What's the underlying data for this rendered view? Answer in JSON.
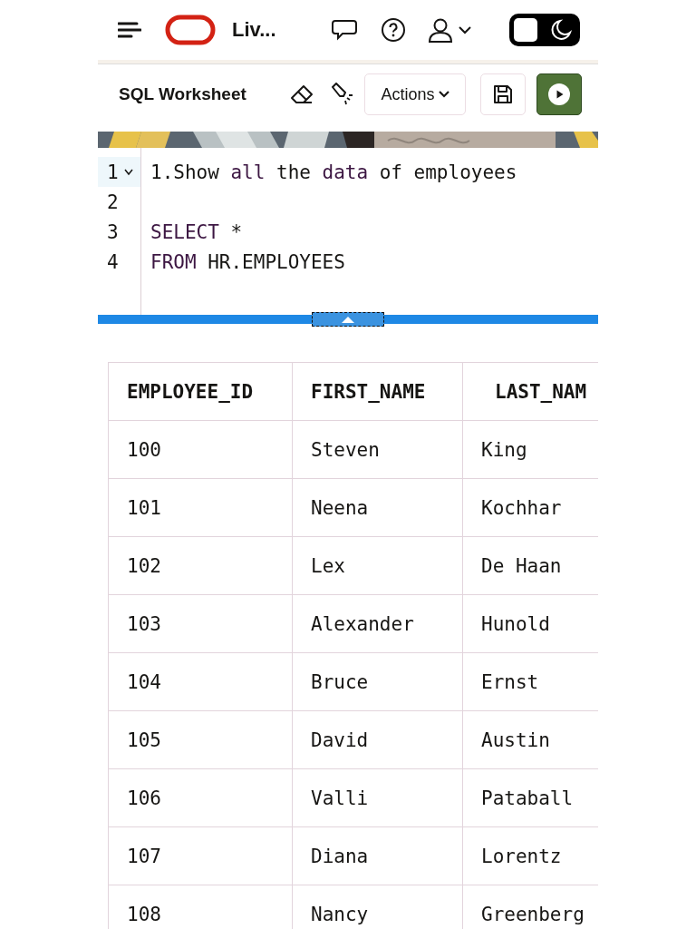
{
  "header": {
    "title": "Liv..."
  },
  "toolbar": {
    "title": "SQL Worksheet",
    "actions_button": "Actions"
  },
  "editor": {
    "lines": [
      {
        "number": "1",
        "active": true,
        "foldable": true,
        "tokens": [
          {
            "text": "1.Show",
            "kind": "plain"
          },
          {
            "text": "all",
            "kind": "keyword"
          },
          {
            "text": "the",
            "kind": "plain"
          },
          {
            "text": "data",
            "kind": "keyword"
          },
          {
            "text": "of",
            "kind": "plain"
          },
          {
            "text": "employees",
            "kind": "plain"
          }
        ]
      },
      {
        "number": "2",
        "active": false,
        "foldable": false
      },
      {
        "number": "3",
        "active": false,
        "foldable": false,
        "tokens": [
          {
            "text": "SELECT",
            "kind": "keyword"
          },
          {
            "text": "*",
            "kind": "plain"
          }
        ]
      },
      {
        "number": "4",
        "active": false,
        "foldable": false,
        "tokens": [
          {
            "text": "FROM",
            "kind": "keyword"
          },
          {
            "text": "HR.EMPLOYEES",
            "kind": "plain"
          }
        ]
      }
    ]
  },
  "table": {
    "columns": [
      "EMPLOYEE_ID",
      "FIRST_NAME",
      "LAST_NAM"
    ],
    "rows": [
      [
        "100",
        "Steven",
        "King"
      ],
      [
        "101",
        "Neena",
        "Kochhar"
      ],
      [
        "102",
        "Lex",
        "De Haan"
      ],
      [
        "103",
        "Alexander",
        "Hunold"
      ],
      [
        "104",
        "Bruce",
        "Ernst"
      ],
      [
        "105",
        "David",
        "Austin"
      ],
      [
        "106",
        "Valli",
        "Pataball"
      ],
      [
        "107",
        "Diana",
        "Lorentz"
      ],
      [
        "108",
        "Nancy",
        "Greenberg"
      ]
    ]
  }
}
